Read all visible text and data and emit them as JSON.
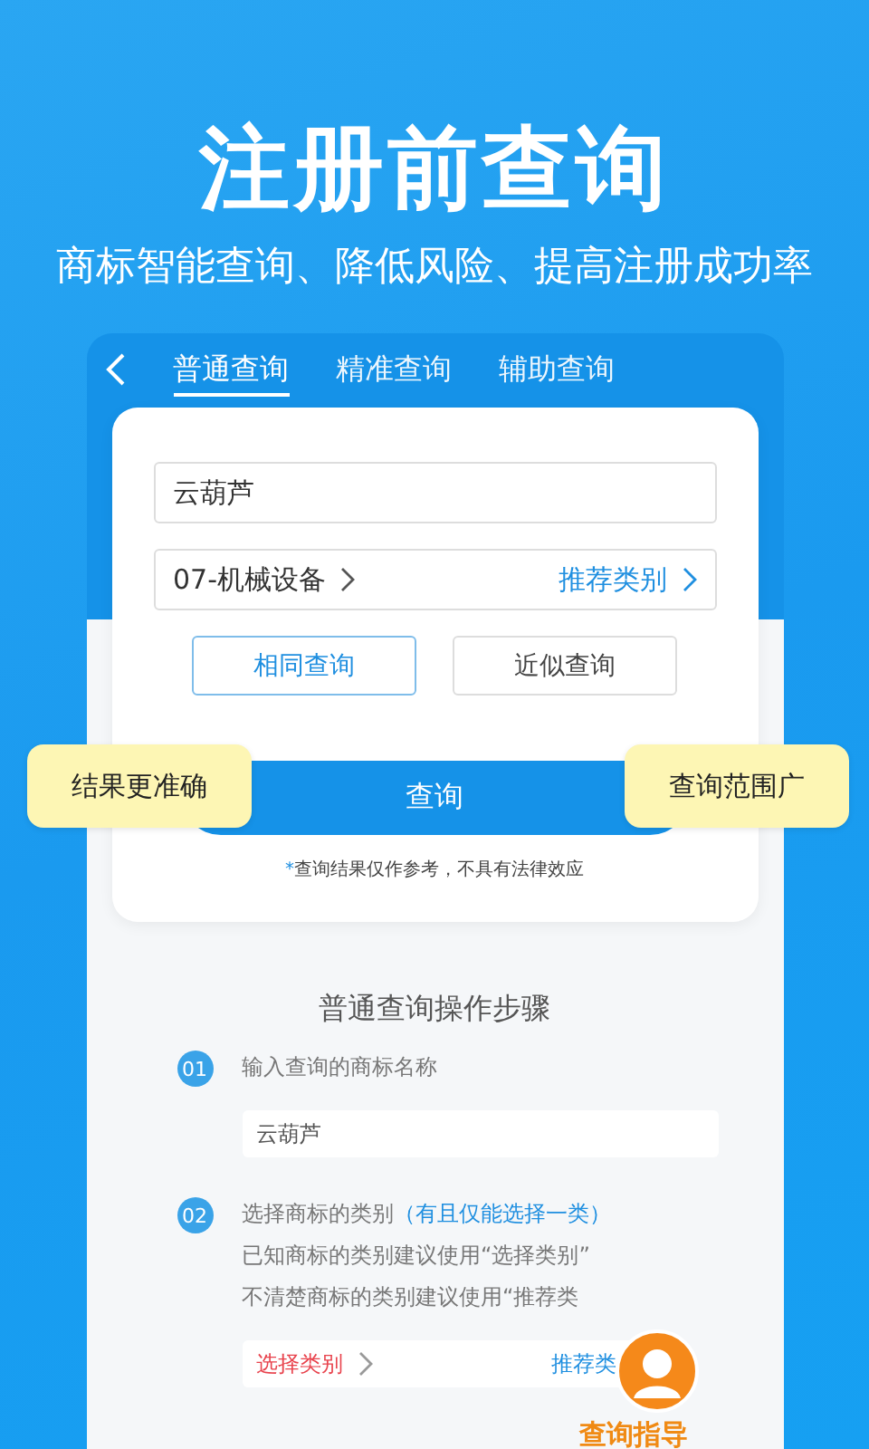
{
  "headline": "注册前查询",
  "subtitle": "商标智能查询、降低风险、提高注册成功率",
  "tabs": [
    {
      "label": "普通查询",
      "selected": true
    },
    {
      "label": "精准查询",
      "selected": false
    },
    {
      "label": "辅助查询",
      "selected": false
    }
  ],
  "name_field": {
    "value": "云葫芦"
  },
  "category_field": {
    "value": "07-机械设备",
    "recommend": "推荐类别"
  },
  "mode_buttons": [
    {
      "label": "相同查询",
      "selected": true
    },
    {
      "label": "近似查询",
      "selected": false
    }
  ],
  "callouts": [
    "结果更准确",
    "查询范围广"
  ],
  "search_button": "查询",
  "disclaimer": {
    "mark": "*",
    "text": "查询结果仅作参考，不具有法律效应"
  },
  "steps_title": "普通查询操作步骤",
  "steps": [
    {
      "number": "01",
      "text": "输入查询的商标名称",
      "example": "云葫芦"
    },
    {
      "number": "02",
      "text": "选择商标的类别",
      "hint": "（有且仅能选择一类）",
      "lines": [
        "已知商标的类别建议使用“选择类别”",
        "不清楚商标的类别建议使用“推荐类"
      ],
      "select": "选择类别",
      "recommend": "推荐类"
    }
  ],
  "guide_label": "查询指导"
}
